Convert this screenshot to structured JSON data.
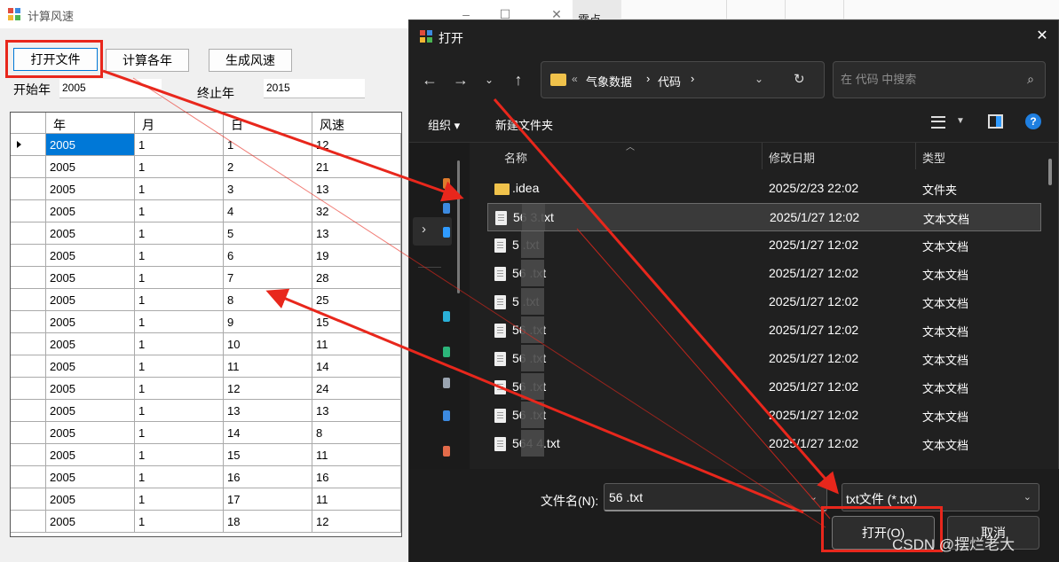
{
  "app": {
    "title": "计算风速",
    "buttons": {
      "open_file": "打开文件",
      "calc_years": "计算各年",
      "gen_wind": "生成风速"
    },
    "start_year_label": "开始年",
    "start_year_value": "2005",
    "end_year_label": "终止年",
    "end_year_value": "2015",
    "bg_window_fragment": "露点",
    "grid": {
      "columns": [
        "年",
        "月",
        "日",
        "风速"
      ],
      "rows": [
        [
          "2005",
          "1",
          "1",
          "12"
        ],
        [
          "2005",
          "1",
          "2",
          "21"
        ],
        [
          "2005",
          "1",
          "3",
          "13"
        ],
        [
          "2005",
          "1",
          "4",
          "32"
        ],
        [
          "2005",
          "1",
          "5",
          "13"
        ],
        [
          "2005",
          "1",
          "6",
          "19"
        ],
        [
          "2005",
          "1",
          "7",
          "28"
        ],
        [
          "2005",
          "1",
          "8",
          "25"
        ],
        [
          "2005",
          "1",
          "9",
          "15"
        ],
        [
          "2005",
          "1",
          "10",
          "11"
        ],
        [
          "2005",
          "1",
          "11",
          "14"
        ],
        [
          "2005",
          "1",
          "12",
          "24"
        ],
        [
          "2005",
          "1",
          "13",
          "13"
        ],
        [
          "2005",
          "1",
          "14",
          "8"
        ],
        [
          "2005",
          "1",
          "15",
          "11"
        ],
        [
          "2005",
          "1",
          "16",
          "16"
        ],
        [
          "2005",
          "1",
          "17",
          "11"
        ],
        [
          "2005",
          "1",
          "18",
          "12"
        ]
      ]
    }
  },
  "dialog": {
    "title": "打开",
    "breadcrumb": [
      "气象数据",
      "代码"
    ],
    "search_placeholder": "在 代码 中搜索",
    "toolbar": {
      "organize": "组织",
      "new_folder": "新建文件夹"
    },
    "columns": {
      "name": "名称",
      "date": "修改日期",
      "type": "类型"
    },
    "files": [
      {
        "name": ".idea",
        "date": "2025/2/23 22:02",
        "type": "文件夹",
        "kind": "folder",
        "selected": false
      },
      {
        "name": "56      3.txt",
        "date": "2025/1/27 12:02",
        "type": "文本文档",
        "kind": "file",
        "selected": true
      },
      {
        "name": "5      .txt",
        "date": "2025/1/27 12:02",
        "type": "文本文档",
        "kind": "file",
        "selected": false
      },
      {
        "name": "56      .txt",
        "date": "2025/1/27 12:02",
        "type": "文本文档",
        "kind": "file",
        "selected": false
      },
      {
        "name": "5      .txt",
        "date": "2025/1/27 12:02",
        "type": "文本文档",
        "kind": "file",
        "selected": false
      },
      {
        "name": "56      .txt",
        "date": "2025/1/27 12:02",
        "type": "文本文档",
        "kind": "file",
        "selected": false
      },
      {
        "name": "56      .txt",
        "date": "2025/1/27 12:02",
        "type": "文本文档",
        "kind": "file",
        "selected": false
      },
      {
        "name": "56      .txt",
        "date": "2025/1/27 12:02",
        "type": "文本文档",
        "kind": "file",
        "selected": false
      },
      {
        "name": "56      .txt",
        "date": "2025/1/27 12:02",
        "type": "文本文档",
        "kind": "file",
        "selected": false
      },
      {
        "name": "564   4.txt",
        "date": "2025/1/27 12:02",
        "type": "文本文档",
        "kind": "file",
        "selected": false
      }
    ],
    "filename_label": "文件名(N):",
    "filename_value": "56     .txt",
    "filetype_value": "txt文件 (*.txt)",
    "open_button": "打开(O)",
    "cancel_button": "取消"
  },
  "watermark": "CSDN @摆烂老大",
  "colors": {
    "annotation": "#e8271c",
    "selection": "#0078d7",
    "dialog_bg": "#202020"
  }
}
